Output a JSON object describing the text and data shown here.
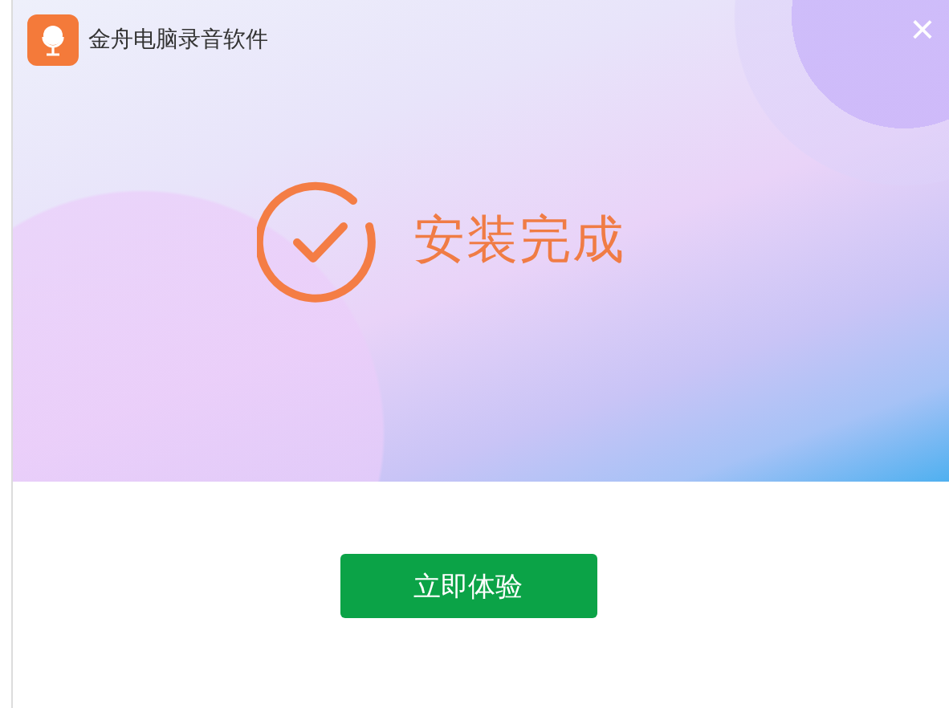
{
  "window": {
    "title": "金舟电脑录音软件",
    "close": "×"
  },
  "status": {
    "text": "安装完成"
  },
  "buttons": [
    {
      "label": "立即体验"
    }
  ]
}
